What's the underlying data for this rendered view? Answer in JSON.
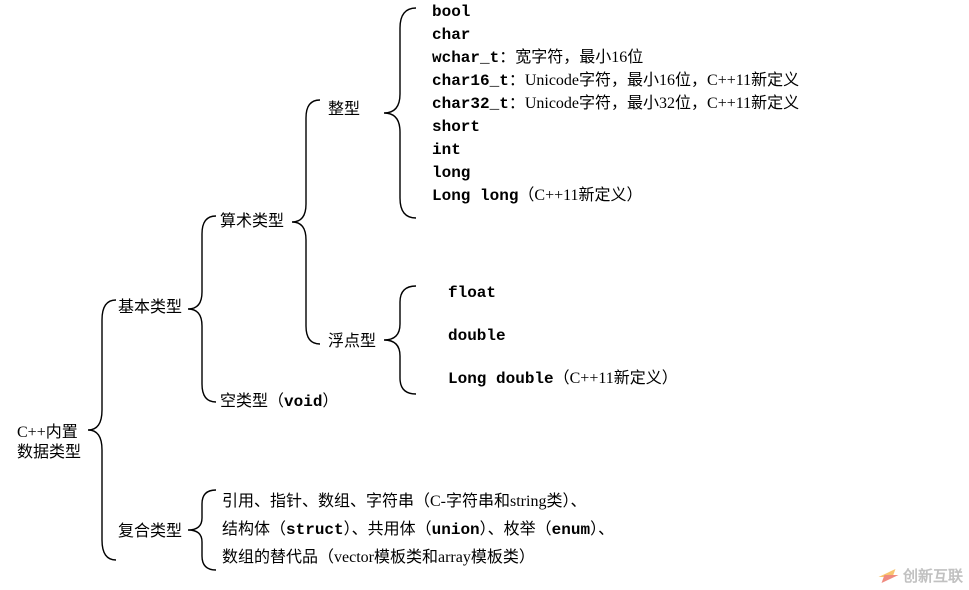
{
  "root": {
    "line1": "C++内置",
    "line2": "数据类型"
  },
  "basic": {
    "label": "基本类型",
    "arith": {
      "label": "算术类型",
      "int": {
        "label": "整型",
        "items": {
          "bool": "bool",
          "char": "char",
          "wchar_prefix": "wchar_t",
          "wchar_suffix": "：宽字符，最小16位",
          "char16_prefix": "char16_t",
          "char16_suffix": "：Unicode字符，最小16位，C++11新定义",
          "char32_prefix": "char32_t",
          "char32_suffix": "：Unicode字符，最小32位，C++11新定义",
          "short": "short",
          "int_kw": "int",
          "long": "long",
          "longlong_prefix": "Long long",
          "longlong_suffix": "（C++11新定义）"
        }
      },
      "float": {
        "label": "浮点型",
        "items": {
          "float": "float",
          "double": "double",
          "longdouble_prefix": "Long double",
          "longdouble_suffix": "（C++11新定义）"
        }
      }
    },
    "void": {
      "prefix": "空类型（",
      "kw": "void",
      "suffix": "）"
    }
  },
  "compound": {
    "label": "复合类型",
    "line1_a": "引用、指针、数组、字符串（C-字符串和string类）、",
    "line2_a": "结构体（",
    "line2_struct": "struct",
    "line2_b": "）、共用体（",
    "line2_union": "union",
    "line2_c": "）、枚举（",
    "line2_enum": "enum",
    "line2_d": "）、",
    "line3": "数组的替代品（vector模板类和array模板类）"
  },
  "watermark": "创新互联"
}
